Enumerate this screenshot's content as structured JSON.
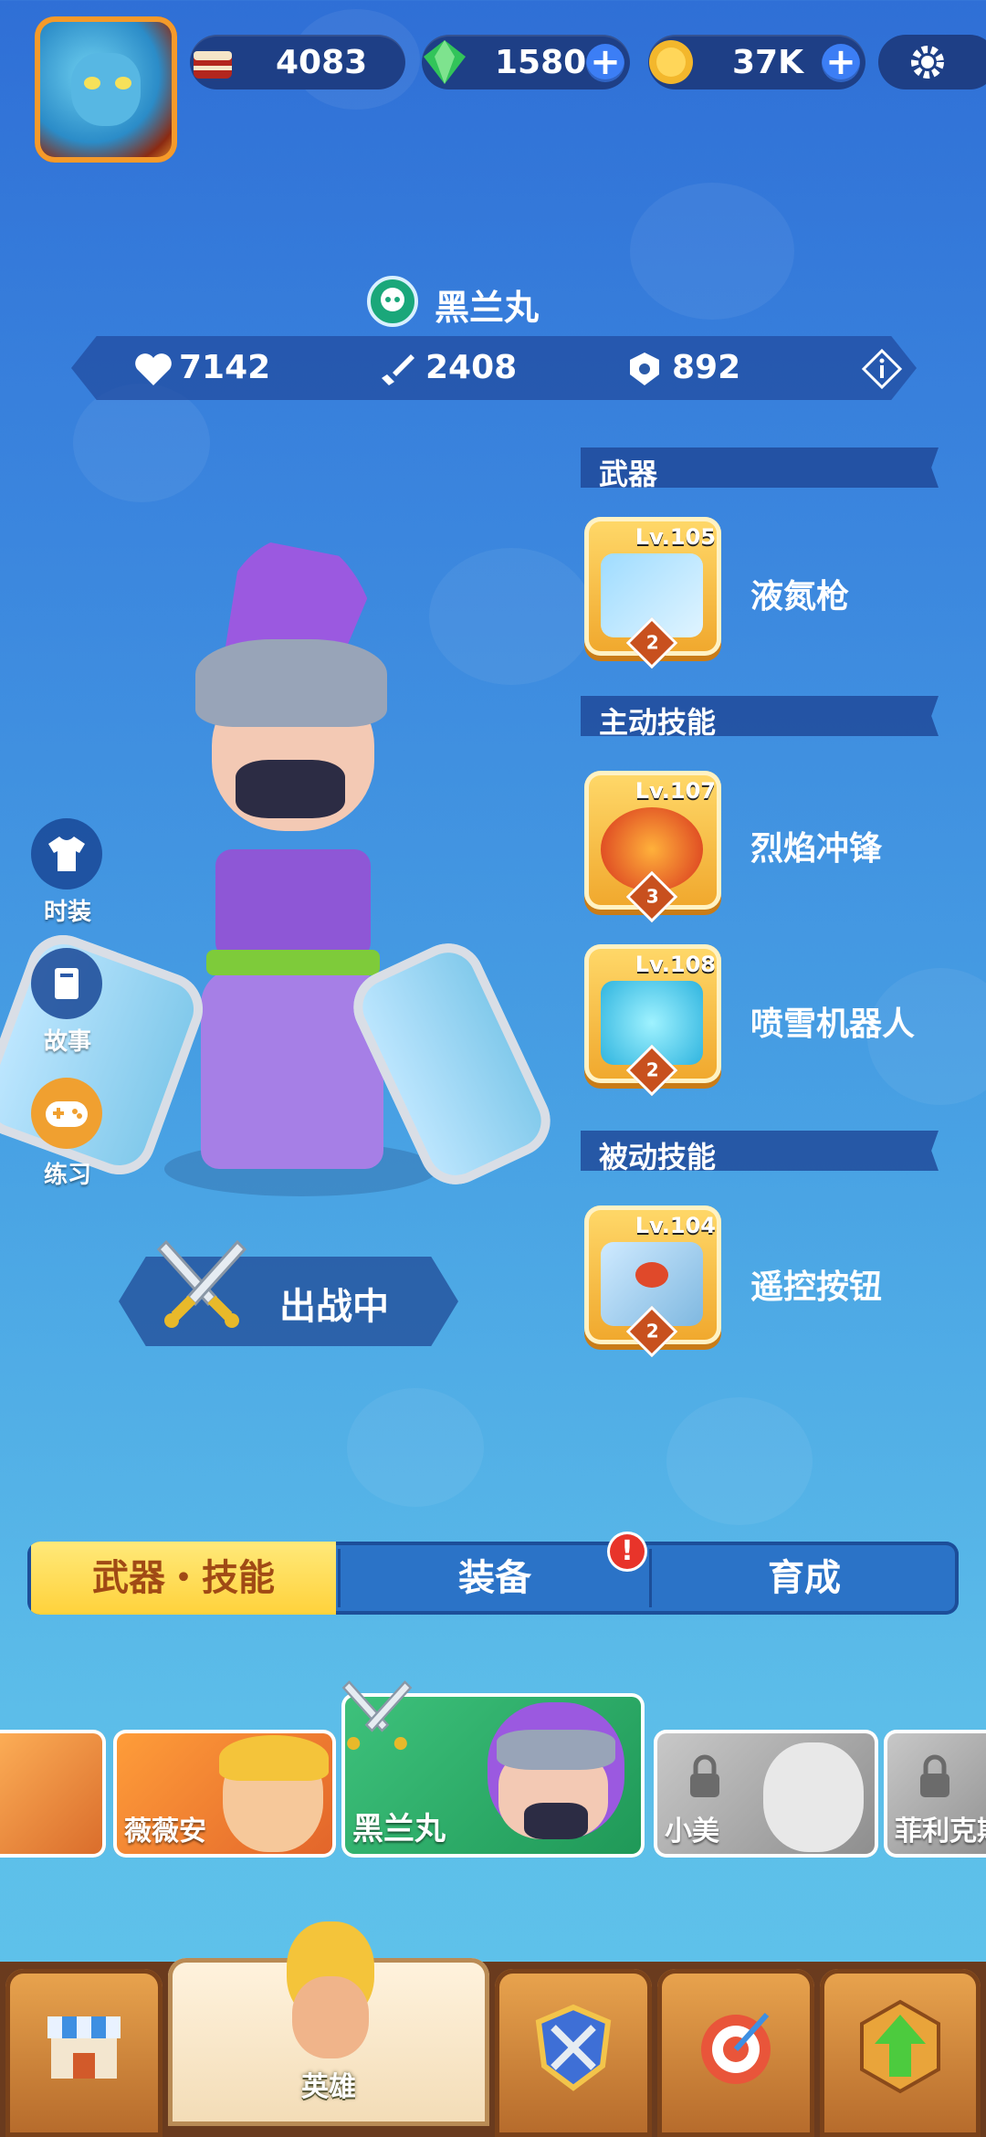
{
  "resources": {
    "cake": "4083",
    "gems": "1580",
    "coins": "37K"
  },
  "hero": {
    "name": "黑兰丸",
    "hp": "7142",
    "attack": "2408",
    "defense": "892"
  },
  "sections": {
    "weapon": "武器",
    "active": "主动技能",
    "passive": "被动技能"
  },
  "items": [
    {
      "level": "Lv.105",
      "name": "液氮枪",
      "stars": "2"
    },
    {
      "level": "Lv.107",
      "name": "烈焰冲锋",
      "stars": "3"
    },
    {
      "level": "Lv.108",
      "name": "喷雪机器人",
      "stars": "2"
    },
    {
      "level": "Lv.104",
      "name": "遥控按钮",
      "stars": "2"
    }
  ],
  "side_buttons": [
    "时装",
    "故事",
    "练习"
  ],
  "deploy_label": "出战中",
  "tabs": [
    "武器・技能",
    "装备",
    "育成"
  ],
  "alert": "!",
  "heroes": [
    "薇薇安",
    "黑兰丸",
    "小美",
    "菲利克斯"
  ],
  "nav": {
    "active_label": "英雄"
  },
  "colors": {
    "accent_yellow": "#ffd23b",
    "panel_blue": "#1e3f86",
    "green_card": "#2fa46a"
  }
}
